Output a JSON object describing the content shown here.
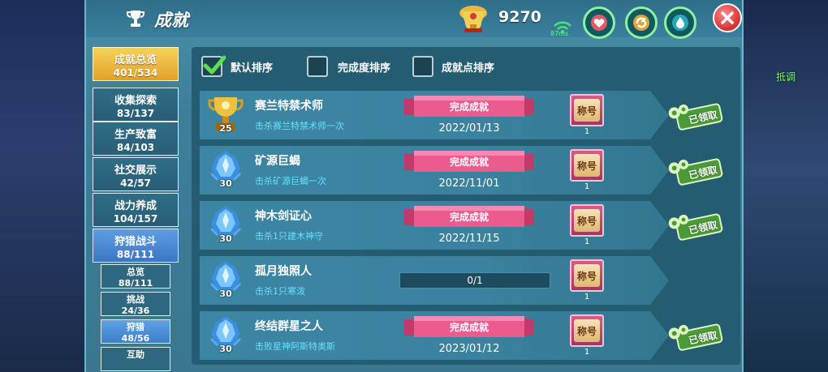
{
  "header": {
    "title": "成就",
    "score": "9270",
    "ping": "87ms"
  },
  "right_bg": {
    "tag1": "抵调",
    "tag2": ""
  },
  "categories": [
    {
      "label": "成就总览",
      "count": "401/534",
      "state": "active"
    },
    {
      "label": "收集探索",
      "count": "83/137",
      "state": ""
    },
    {
      "label": "生产致富",
      "count": "84/103",
      "state": ""
    },
    {
      "label": "社交展示",
      "count": "42/57",
      "state": ""
    },
    {
      "label": "战力养成",
      "count": "104/157",
      "state": ""
    },
    {
      "label": "狩猎战斗",
      "count": "88/111",
      "state": "selected"
    }
  ],
  "subcategories": [
    {
      "label": "总览",
      "count": "88/111",
      "state": ""
    },
    {
      "label": "挑战",
      "count": "24/36",
      "state": ""
    },
    {
      "label": "狩猎",
      "count": "48/56",
      "state": "selected"
    },
    {
      "label": "互助",
      "count": "",
      "state": ""
    }
  ],
  "sort_options": [
    {
      "label": "默认排序",
      "checked": true
    },
    {
      "label": "完成度排序",
      "checked": false
    },
    {
      "label": "成就点排序",
      "checked": false
    }
  ],
  "achievements": [
    {
      "title": "赛兰特禁术师",
      "desc": "击杀赛兰特禁术师一次",
      "points": "25",
      "medal": "gold",
      "status": "完成成就",
      "date": "2022/01/13",
      "completed": true,
      "progress": "",
      "badge": "称号",
      "badge_count": "1",
      "claim": "已领取"
    },
    {
      "title": "矿源巨蝎",
      "desc": "击杀矿源巨蝎一次",
      "points": "30",
      "medal": "crystal",
      "status": "完成成就",
      "date": "2022/11/01",
      "completed": true,
      "progress": "",
      "badge": "称号",
      "badge_count": "1",
      "claim": "已领取"
    },
    {
      "title": "神木剑证心",
      "desc": "击杀1只建木神守",
      "points": "30",
      "medal": "crystal",
      "status": "完成成就",
      "date": "2022/11/15",
      "completed": true,
      "progress": "",
      "badge": "称号",
      "badge_count": "1",
      "claim": "已领取"
    },
    {
      "title": "孤月独照人",
      "desc": "击杀1只寒泼",
      "points": "30",
      "medal": "crystal",
      "status": "",
      "date": "",
      "completed": false,
      "progress": "0/1",
      "progress_fraction": 0,
      "badge": "称号",
      "badge_count": "1",
      "claim": ""
    },
    {
      "title": "终结群星之人",
      "desc": "击败星神阿斯特奥斯",
      "points": "30",
      "medal": "crystal",
      "status": "完成成就",
      "date": "2023/01/12",
      "completed": true,
      "progress": "",
      "badge": "称号",
      "badge_count": "1",
      "claim": "已领取"
    }
  ],
  "colors": {
    "accent_gold": "#e2a12a",
    "selected_blue": "#3d76c4",
    "ribbon_pink": "#e8528a",
    "desc_cyan": "#62e1ff"
  }
}
